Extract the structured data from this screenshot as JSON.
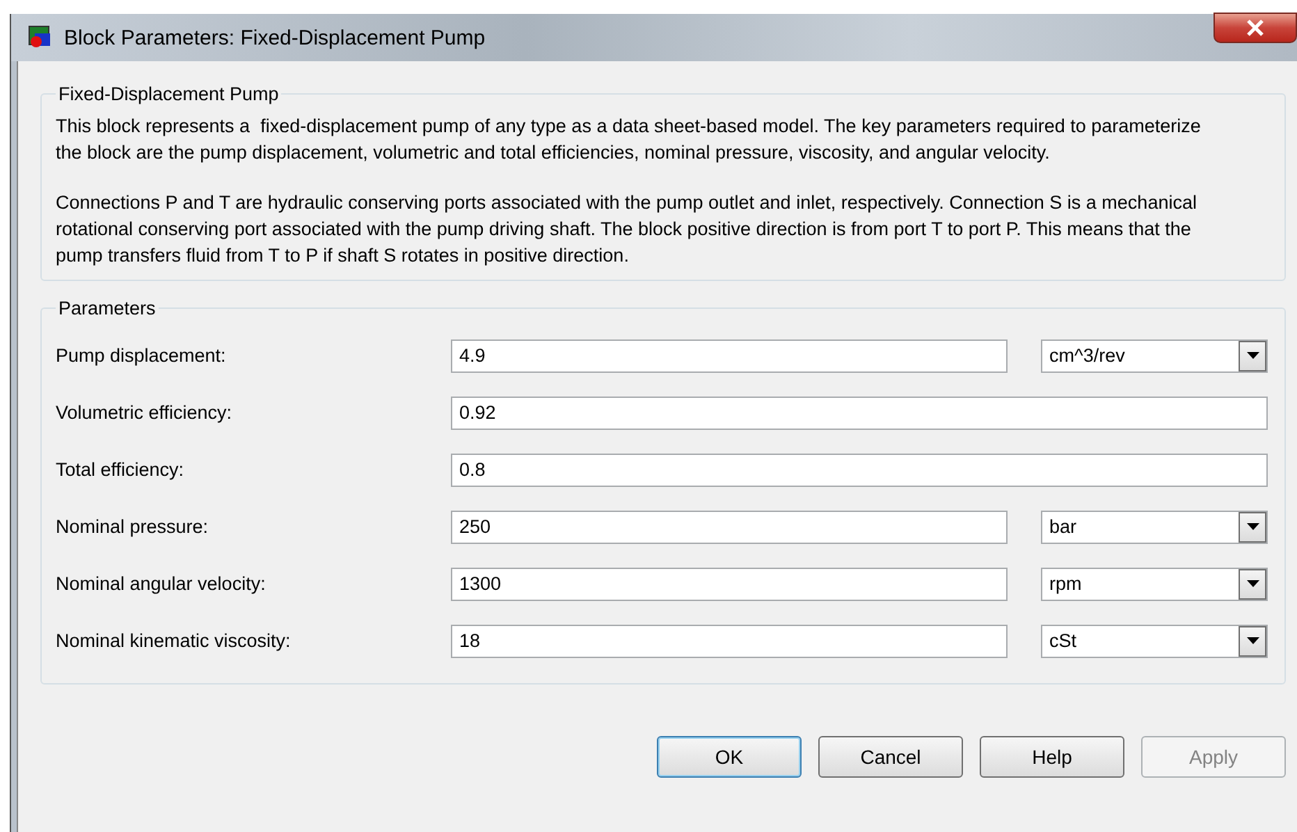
{
  "window": {
    "title": "Block Parameters: Fixed-Displacement Pump"
  },
  "description": {
    "title": "Fixed-Displacement Pump",
    "paragraphs": [
      "This block represents a  fixed-displacement pump of any type as a data sheet-based model. The key parameters required to parameterize the block are the pump displacement, volumetric and total efficiencies, nominal pressure, viscosity, and angular velocity.",
      "Connections P and T are hydraulic conserving ports associated with the pump outlet and inlet, respectively. Connection S is a mechanical rotational conserving port associated with the pump driving shaft. The block positive direction is from port T to port P. This means that the pump transfers fluid from T to P if shaft S rotates in positive direction."
    ]
  },
  "parameters": {
    "title": "Parameters",
    "rows": [
      {
        "label": "Pump displacement:",
        "value": "4.9",
        "unit": "cm^3/rev"
      },
      {
        "label": "Volumetric efficiency:",
        "value": "0.92"
      },
      {
        "label": "Total efficiency:",
        "value": "0.8"
      },
      {
        "label": "Nominal pressure:",
        "value": "250",
        "unit": "bar"
      },
      {
        "label": "Nominal angular velocity:",
        "value": "1300",
        "unit": "rpm"
      },
      {
        "label": "Nominal kinematic viscosity:",
        "value": "18",
        "unit": "cSt"
      }
    ]
  },
  "buttons": [
    {
      "label": "OK",
      "focused": true,
      "disabled": false
    },
    {
      "label": "Cancel",
      "focused": false,
      "disabled": false
    },
    {
      "label": "Help",
      "focused": false,
      "disabled": false
    },
    {
      "label": "Apply",
      "focused": false,
      "disabled": true
    }
  ]
}
